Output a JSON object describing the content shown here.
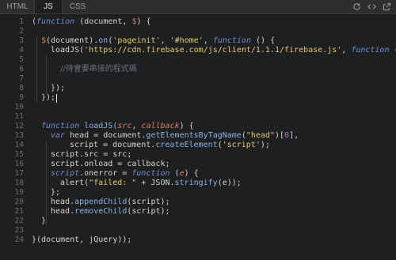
{
  "tabs": [
    {
      "label": "HTML",
      "active": false
    },
    {
      "label": "JS",
      "active": true
    },
    {
      "label": "CSS",
      "active": false
    }
  ],
  "toolbar_icons": [
    "refresh-icon",
    "code-icon",
    "popout-icon"
  ],
  "line_numbers": [
    "1",
    "2",
    "3",
    "4",
    "5",
    "6",
    "7",
    "8",
    "9",
    "10",
    "11",
    "12",
    "13",
    "14",
    "15",
    "16",
    "17",
    "18",
    "19",
    "20",
    "21",
    "22",
    "23",
    "24"
  ],
  "code": {
    "l1_a": "(",
    "l1_b": "function",
    "l1_c": " (document, ",
    "l1_d": "$",
    "l1_e": ") {",
    "l3_a": "$",
    "l3_b": "(document).",
    "l3_c": "on",
    "l3_d": "(",
    "l3_e": "'pageinit'",
    "l3_f": ", ",
    "l3_g": "'#home'",
    "l3_h": ", ",
    "l3_i": "function",
    "l3_j": " () {",
    "l4_a": "loadJS(",
    "l4_b": "'https://cdn.firebase.com/js/client/1.1.1/firebase.js'",
    "l4_c": ", ",
    "l4_d": "function",
    "l4_e": " () {",
    "l6_a": "//待會要串接的程式碼",
    "l8_a": "});",
    "l9_a": "});",
    "l12_a": "function",
    "l12_b": " loadJS(",
    "l12_c": "src",
    "l12_d": ", ",
    "l12_e": "callback",
    "l12_f": ") {",
    "l13_a": "var",
    "l13_b": " head = document.",
    "l13_c": "getElementsByTagName",
    "l13_d": "(",
    "l13_e": "\"head\"",
    "l13_f": ")[",
    "l13_g": "0",
    "l13_h": "],",
    "l14_a": "script = document.",
    "l14_b": "createElement",
    "l14_c": "(",
    "l14_d": "'script'",
    "l14_e": ");",
    "l15_a": "script.src = src;",
    "l16_a": "script.onload = callback;",
    "l17_a": "script",
    "l17_b": ".onerror = ",
    "l17_c": "function",
    "l17_d": " (",
    "l17_e": "e",
    "l17_f": ") {",
    "l18_a": "alert(",
    "l18_b": "\"failed: \"",
    "l18_c": " + JSON.",
    "l18_d": "stringify",
    "l18_e": "(e));",
    "l19_a": "};",
    "l20_a": "head.",
    "l20_b": "appendChild",
    "l20_c": "(script);",
    "l21_a": "head.",
    "l21_b": "removeChild",
    "l21_c": "(script);",
    "l22_a": "}",
    "l24_a": "}(document, jQuery));"
  }
}
